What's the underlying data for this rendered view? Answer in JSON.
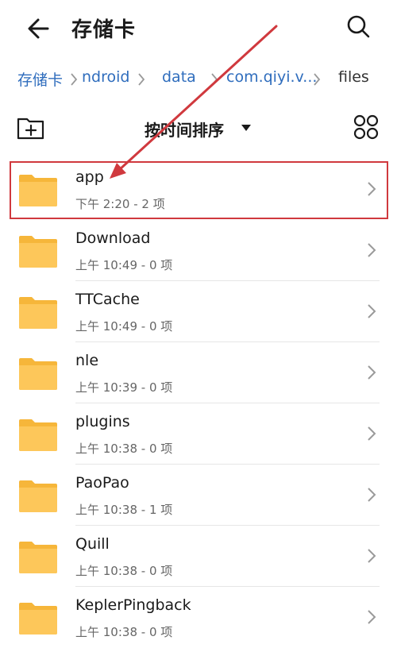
{
  "header": {
    "title": "存储卡",
    "back_icon": "back-arrow-icon",
    "search_icon": "search-icon"
  },
  "breadcrumb": [
    {
      "label": "存储卡"
    },
    {
      "label": "ndroid"
    },
    {
      "label": "data"
    },
    {
      "label": "com.qiyi.v..."
    },
    {
      "label": "files"
    }
  ],
  "toolbar": {
    "sort_label": "按时间排序",
    "new_folder_icon": "new-folder-icon",
    "grid_icon": "grid-view-icon"
  },
  "files": [
    {
      "name": "app",
      "meta": "下午 2:20  - 2 项"
    },
    {
      "name": "Download",
      "meta": "上午 10:49  - 0 项"
    },
    {
      "name": "TTCache",
      "meta": "上午 10:49  - 0 项"
    },
    {
      "name": "nle",
      "meta": "上午 10:39  - 0 项"
    },
    {
      "name": "plugins",
      "meta": "上午 10:38  - 0 项"
    },
    {
      "name": "PaoPao",
      "meta": "上午 10:38  - 1 项"
    },
    {
      "name": "Quill",
      "meta": "上午 10:38  - 0 项"
    },
    {
      "name": "KeplerPingback",
      "meta": "上午 10:38  - 0 项"
    }
  ],
  "colors": {
    "accent": "#2f6dbd",
    "folder": "#fdc75a",
    "folder_tab": "#f6b63a",
    "annotation": "#d0393e"
  }
}
